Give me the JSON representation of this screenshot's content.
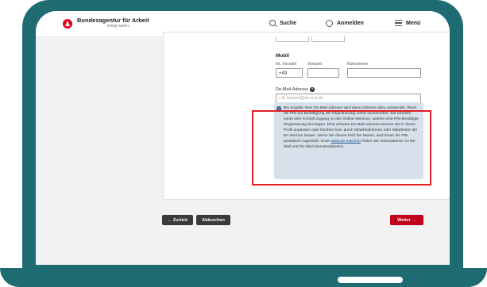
{
  "header": {
    "brand": "Bundesagentur für Arbeit",
    "tagline": "bringt weiter.",
    "search_label": "Suche",
    "login_label": "Anmelden",
    "menu_label": "Menü"
  },
  "form": {
    "section_title": "Mobil",
    "fields": [
      {
        "label": "Int. Vorwahl",
        "value": "+49"
      },
      {
        "label": "Vorwahl",
        "value": ""
      },
      {
        "label": "Rufnummer",
        "value": ""
      }
    ],
    "email_label": "De-Mail-Adresse",
    "email_placeholder": "z.B. beispiel@de-mail.de"
  },
  "info": {
    "text_before_link": "Bei Angabe Ihrer De-Mail-Adresse wird diese Adresse dazu verwendet, Ihnen die PIN zur Bestätigung der Registrierung sofort zuzusenden. Sie erhalten somit sehr schnell Zugang zu den Online-Services, welche eine PIN-bestätigte Registrierung benötigen. Eine erfasste De-Mail-Adresse können Sie in Ihrem Profil anpassen oder löschen bzw. durch Mitarbeiterinnen oder Mitarbeiter der BA löschen lassen. Wenn Sie dieses Feld frei lassen, wird Ihnen die PIN postalisch zugestellt. Unter ",
    "link_text": "www.de-mail.info",
    "text_after_link": " finden Sie Informationen zu De-Mail und De-Mail-Diensteanbietern."
  },
  "actions": {
    "back_label": "← Zurück",
    "cancel_label": "Abbrechen",
    "next_label": "Weiter →"
  },
  "colors": {
    "frame": "#1f6b72",
    "primary_red": "#c2001b",
    "highlight": "#e41e26",
    "infobox": "#d6e1ec"
  }
}
